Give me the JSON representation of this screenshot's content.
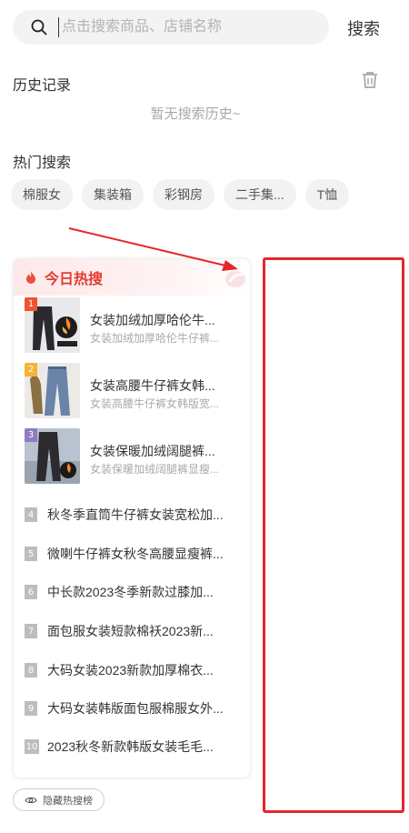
{
  "search": {
    "placeholder": "点击搜索商品、店铺名称",
    "button_label": "搜索"
  },
  "history": {
    "title": "历史记录",
    "empty_text": "暂无搜索历史~"
  },
  "hot_search": {
    "title": "热门搜索",
    "tags": [
      "棉服女",
      "集装箱",
      "彩钢房",
      "二手集...",
      "T恤"
    ]
  },
  "today_hot": {
    "title": "今日热搜",
    "image_items": [
      {
        "rank": "1",
        "title": "女装加绒加厚哈伦牛...",
        "subtitle": "女装加绒加厚哈伦牛仔裤..."
      },
      {
        "rank": "2",
        "title": "女装高腰牛仔裤女韩...",
        "subtitle": "女装高腰牛仔裤女韩版宽..."
      },
      {
        "rank": "3",
        "title": "女装保暖加绒阔腿裤...",
        "subtitle": "女装保暖加绒阔腿裤显瘦..."
      }
    ],
    "text_items": [
      {
        "rank": "4",
        "title": "秋冬季直筒牛仔裤女装宽松加..."
      },
      {
        "rank": "5",
        "title": "微喇牛仔裤女秋冬高腰显瘦裤..."
      },
      {
        "rank": "6",
        "title": "中长款2023冬季新款过膝加..."
      },
      {
        "rank": "7",
        "title": "面包服女装短款棉袄2023新..."
      },
      {
        "rank": "8",
        "title": "大码女装2023新款加厚棉衣..."
      },
      {
        "rank": "9",
        "title": "大码女装韩版面包服棉服女外..."
      },
      {
        "rank": "10",
        "title": "2023秋冬新款韩版女装毛毛..."
      }
    ]
  },
  "hide_button": {
    "label": "隐藏热搜榜"
  },
  "colors": {
    "accent": "#e33a2f",
    "annotation_red": "#e4262c",
    "rank1": "#f0532d",
    "rank2": "#f5b234",
    "rank3": "#8e7cc3",
    "rank_other": "#bdbdbd"
  }
}
